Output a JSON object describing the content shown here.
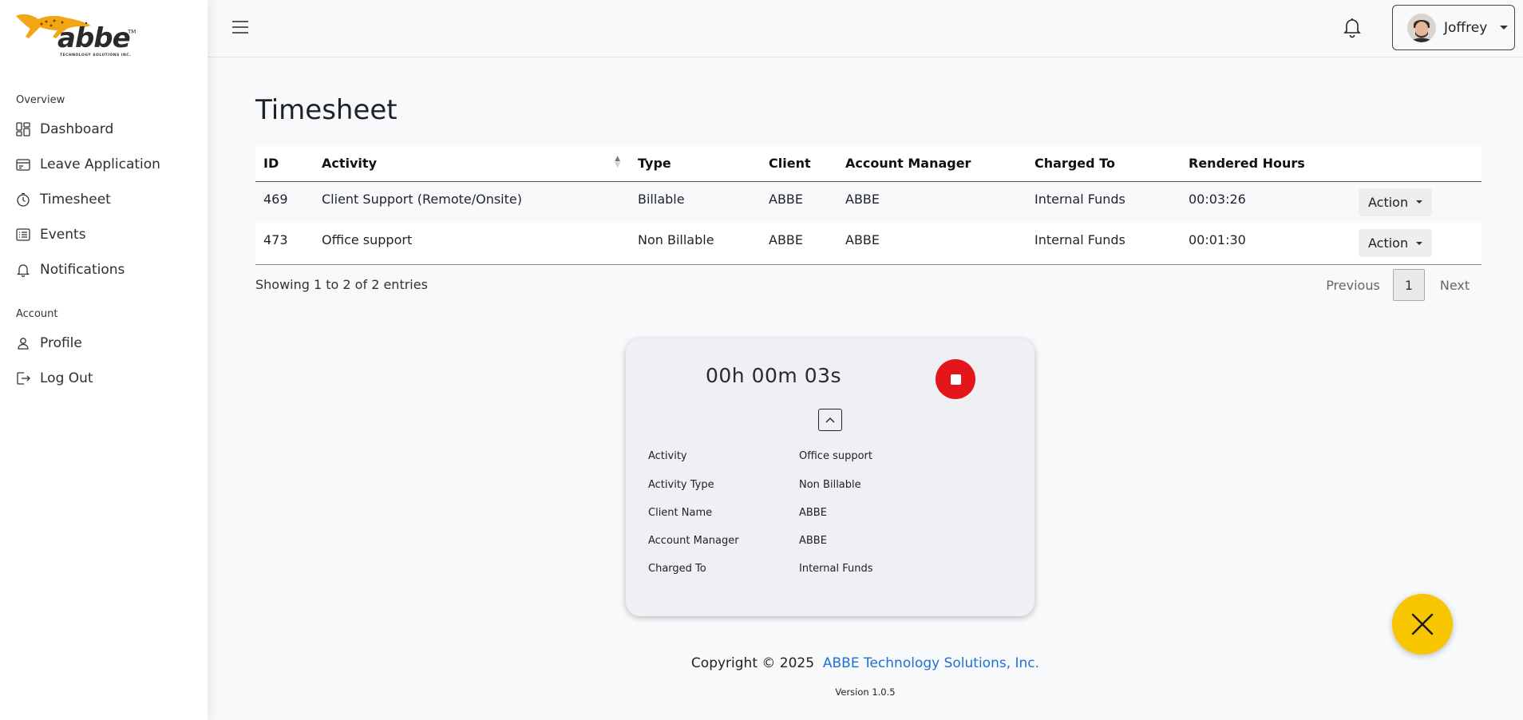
{
  "brand": {
    "name": "abbe",
    "trademark": "TM",
    "tagline": "TECHNOLOGY SOLUTIONS INC.",
    "logo_color": "#f2a614"
  },
  "sidebar": {
    "overview_label": "Overview",
    "account_label": "Account",
    "items": [
      {
        "label": "Dashboard",
        "icon": "dashboard-icon"
      },
      {
        "label": "Leave Application",
        "icon": "calendar-card-icon"
      },
      {
        "label": "Timesheet",
        "icon": "stopwatch-icon"
      },
      {
        "label": "Events",
        "icon": "list-card-icon"
      },
      {
        "label": "Notifications",
        "icon": "bell-icon"
      }
    ],
    "account_items": [
      {
        "label": "Profile",
        "icon": "user-icon"
      },
      {
        "label": "Log Out",
        "icon": "logout-icon"
      }
    ]
  },
  "topbar": {
    "user_name": "Joffrey"
  },
  "page": {
    "title": "Timesheet"
  },
  "table": {
    "headers": [
      "ID",
      "Activity",
      "Type",
      "Client",
      "Account Manager",
      "Charged To",
      "Rendered Hours"
    ],
    "rows": [
      {
        "id": "469",
        "activity": "Client Support (Remote/Onsite)",
        "type": "Billable",
        "client": "ABBE",
        "account_manager": "ABBE",
        "charged_to": "Internal Funds",
        "hours": "00:03:26",
        "action": "Action"
      },
      {
        "id": "473",
        "activity": "Office support",
        "type": "Non Billable",
        "client": "ABBE",
        "account_manager": "ABBE",
        "charged_to": "Internal Funds",
        "hours": "00:01:30",
        "action": "Action"
      }
    ],
    "showing": "Showing 1 to 2 of 2 entries",
    "pagination": {
      "previous": "Previous",
      "current": "1",
      "next": "Next"
    }
  },
  "timer": {
    "elapsed": "00h 00m 03s",
    "stop_color": "#e4161b",
    "details": [
      {
        "label": "Activity",
        "value": "Office support"
      },
      {
        "label": "Activity Type",
        "value": "Non Billable"
      },
      {
        "label": "Client Name",
        "value": "ABBE"
      },
      {
        "label": "Account Manager",
        "value": "ABBE"
      },
      {
        "label": "Charged To",
        "value": "Internal Funds"
      }
    ]
  },
  "fab": {
    "icon": "close-icon",
    "color": "#f7c600"
  },
  "footer": {
    "copyright": "Copyright © 2025",
    "company": "ABBE Technology Solutions, Inc.",
    "version": "Version 1.0.5"
  }
}
